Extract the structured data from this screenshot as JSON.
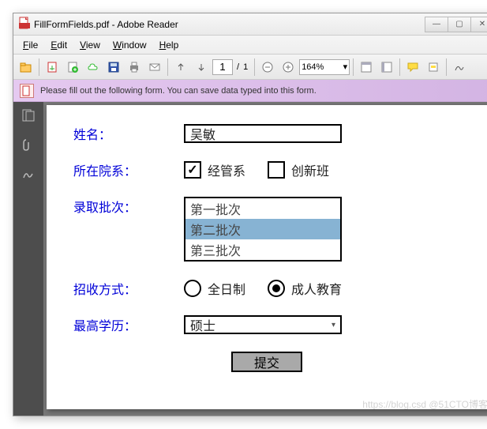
{
  "window": {
    "title": "FillFormFields.pdf - Adobe Reader"
  },
  "menu": {
    "file": "File",
    "edit": "Edit",
    "view": "View",
    "window": "Window",
    "help": "Help"
  },
  "toolbar": {
    "page_current": "1",
    "page_sep": "/",
    "page_total": "1",
    "zoom": "164%"
  },
  "infobar": {
    "msg": "Please fill out the following form. You can save data typed into this form."
  },
  "form": {
    "labels": {
      "name": "姓名：",
      "dept": "所在院系：",
      "batch": "录取批次：",
      "mode": "招收方式：",
      "edu": "最高学历："
    },
    "name_value": "吴敏",
    "dept_opt1": {
      "label": "经管系",
      "checked": true
    },
    "dept_opt2": {
      "label": "创新班",
      "checked": false
    },
    "batch": {
      "items": [
        "第一批次",
        "第二批次",
        "第三批次"
      ],
      "selected_index": 1
    },
    "mode_opt1": {
      "label": "全日制",
      "checked": false
    },
    "mode_opt2": {
      "label": "成人教育",
      "checked": true
    },
    "edu_value": "硕士",
    "submit": "提交"
  },
  "watermark": "https://blog.csd  @51CTO博客"
}
